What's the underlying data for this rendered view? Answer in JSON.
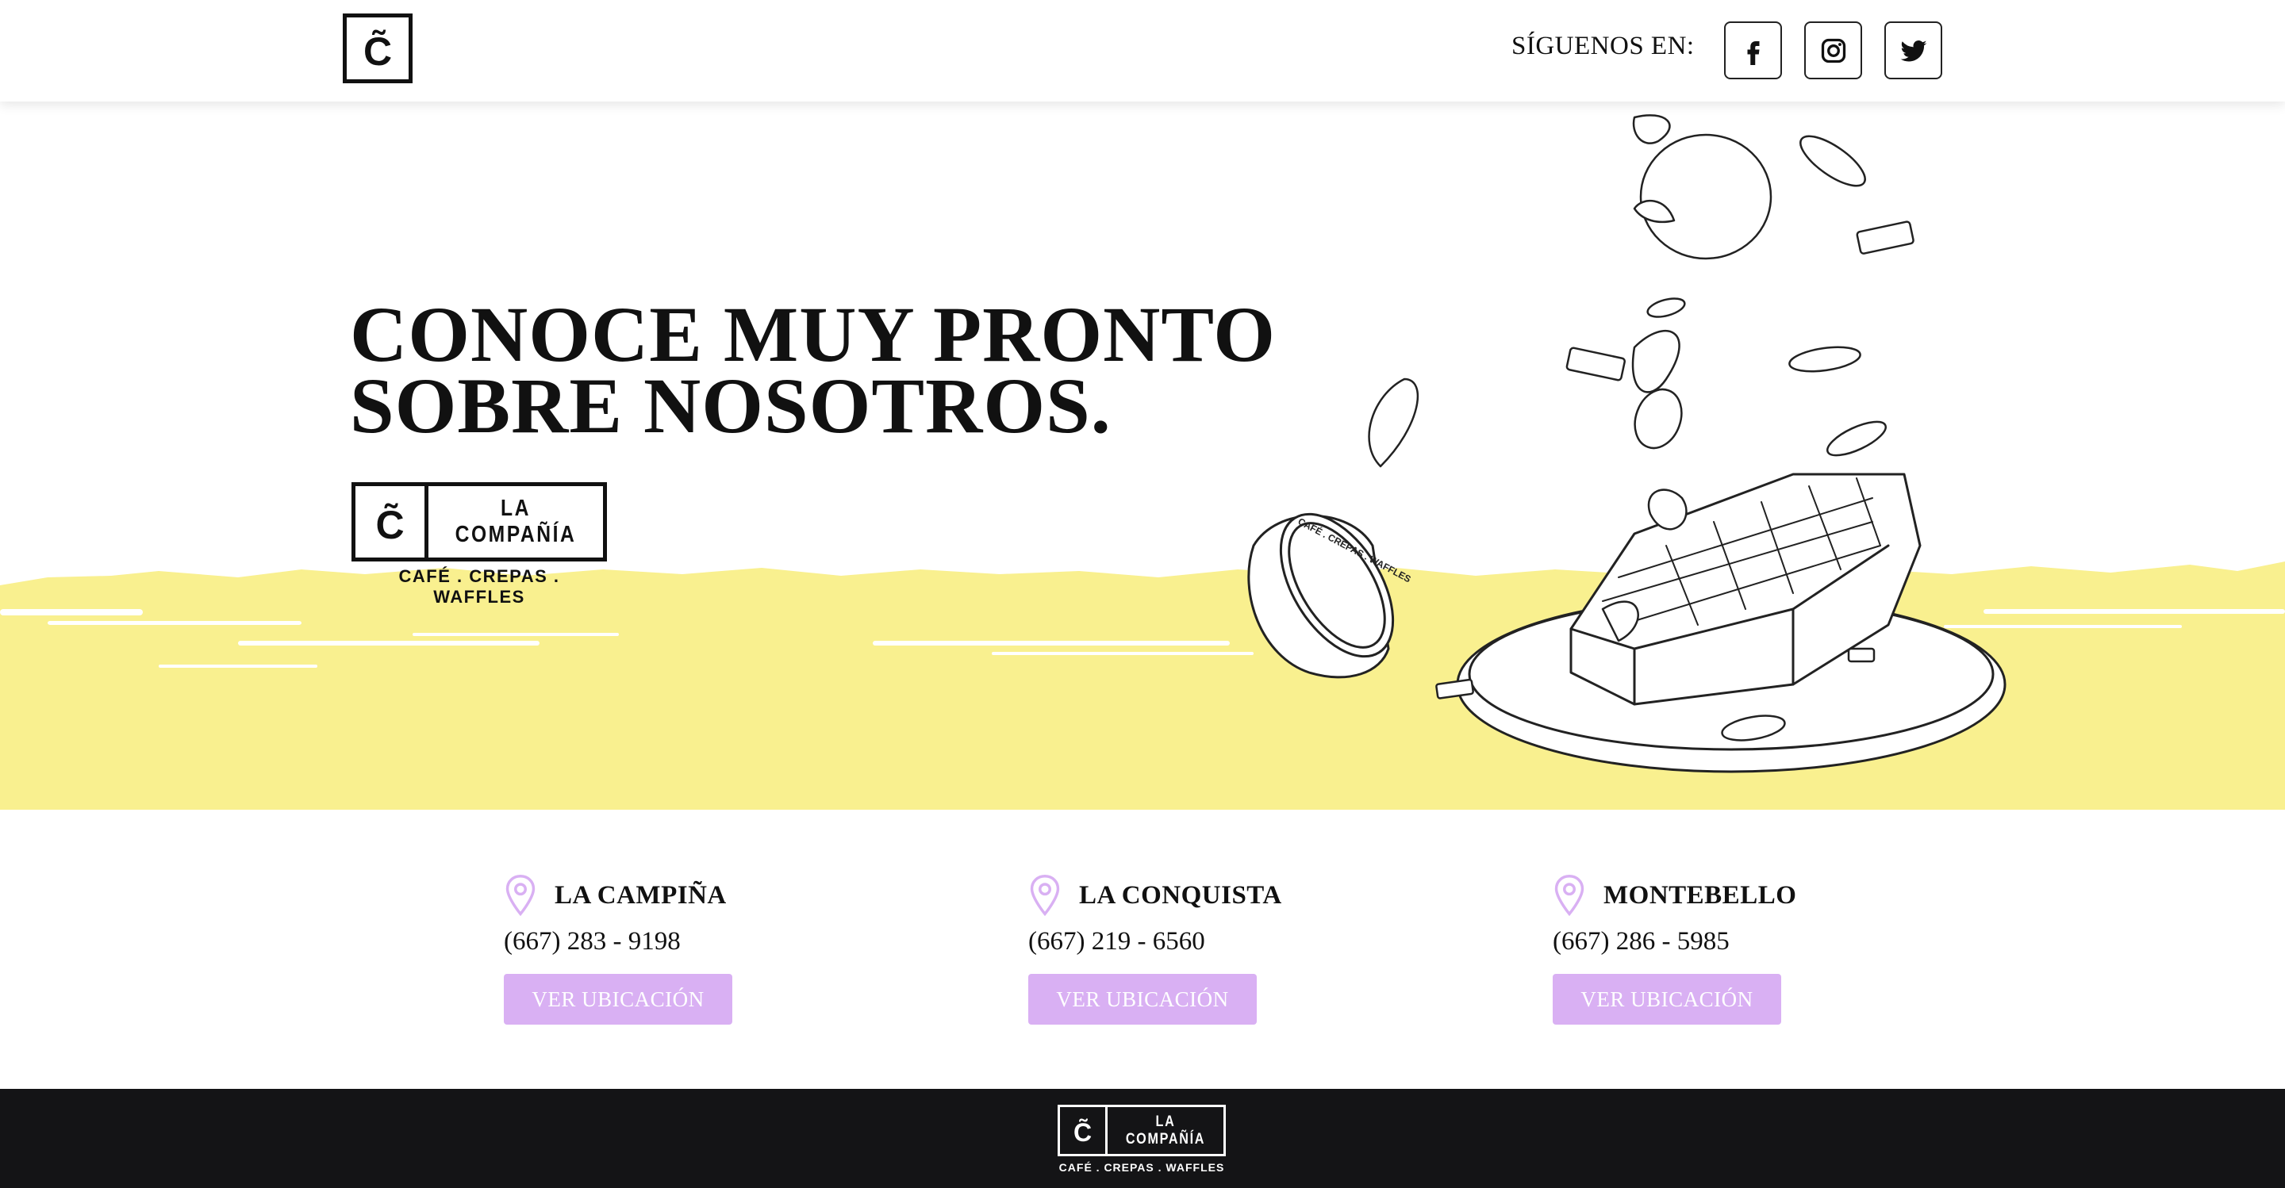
{
  "header": {
    "logo_glyph": "C̃",
    "follow_label": "SÍGUENOS EN:",
    "social": [
      {
        "icon": "facebook-icon"
      },
      {
        "icon": "instagram-icon"
      },
      {
        "icon": "twitter-icon"
      }
    ]
  },
  "hero": {
    "title_line1": "CONOCE MUY PRONTO",
    "title_line2": "SOBRE NOSOTROS.",
    "brand": {
      "glyph": "C̃",
      "name": "LA COMPAÑÍA",
      "tagline": "CAFÉ . CREPAS . WAFFLES"
    },
    "cup_text": "CAFÉ . CREPAS . WAFFLES",
    "accent_color": "#f9f08f"
  },
  "locations": [
    {
      "name": "LA CAMPIÑA",
      "phone": "(667) 283 - 9198",
      "button": "VER UBICACIÓN"
    },
    {
      "name": "LA CONQUISTA",
      "phone": "(667) 219 - 6560",
      "button": "VER UBICACIÓN"
    },
    {
      "name": "MONTEBELLO",
      "phone": "(667) 286 - 5985",
      "button": "VER UBICACIÓN"
    }
  ],
  "colors": {
    "button": "#d9b0f3",
    "pin": "#d9b0f3",
    "footer": "#141416"
  },
  "footer": {
    "glyph": "C̃",
    "name": "LA COMPAÑÍA",
    "tagline": "CAFÉ . CREPAS . WAFFLES"
  }
}
